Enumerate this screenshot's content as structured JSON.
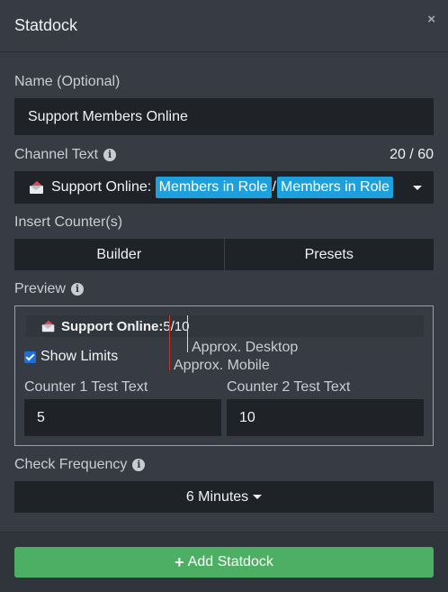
{
  "header": {
    "title": "Statdock",
    "close": "×"
  },
  "name": {
    "label": "Name (Optional)",
    "value": "Support Members Online"
  },
  "channel_text": {
    "label": "Channel Text",
    "info": "i",
    "count": "20 / 60",
    "prefix": "Support Online: ",
    "chip1": "Members in Role",
    "separator": "/",
    "chip2": "Members in Role"
  },
  "insert_counter": {
    "label": "Insert Counter(s)",
    "builder": "Builder",
    "presets": "Presets"
  },
  "preview": {
    "label": "Preview",
    "info": "i",
    "channel_name": "Support Online:",
    "value": "5/10",
    "desktop_label": "Approx. Desktop",
    "mobile_label": "Approx. Mobile",
    "show_limits_label": "Show Limits",
    "show_limits_checked": true,
    "counter1_label": "Counter 1 Test Text",
    "counter1_value": "5",
    "counter2_label": "Counter 2 Test Text",
    "counter2_value": "10"
  },
  "check_frequency": {
    "label": "Check Frequency",
    "info": "i",
    "value": "6 Minutes"
  },
  "footer": {
    "add_label": "Add Statdock",
    "add_icon": "plus-icon"
  },
  "colors": {
    "accent": "#1ea0dc",
    "success": "#4caf63",
    "checkbox": "#1e6fd9",
    "mobile_line": "#c0392b"
  }
}
